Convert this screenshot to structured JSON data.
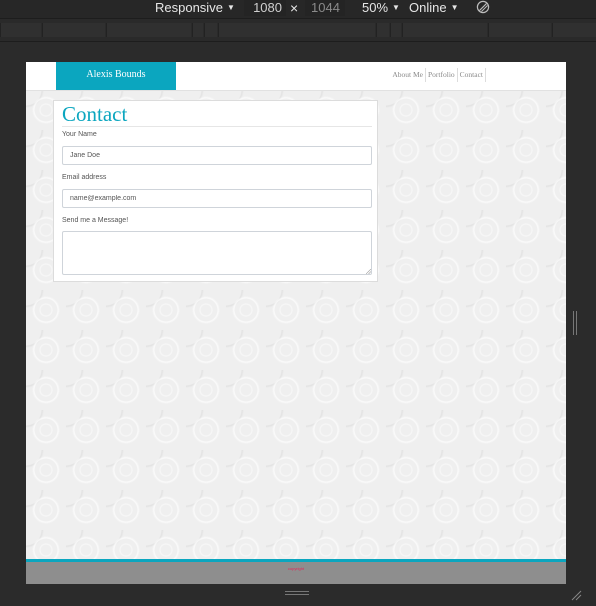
{
  "devtools": {
    "device": "Responsive",
    "width": "1080",
    "separator": "×",
    "height": "1044",
    "zoom": "50%",
    "network": "Online",
    "icons": {
      "caret": "caret-down-icon",
      "rotate": "rotate-icon",
      "resize_corner": "resize-corner-icon"
    }
  },
  "site": {
    "brand": "Alexis Bounds",
    "nav": [
      "About Me",
      "Portfolio",
      "Contact"
    ],
    "accent": "#0ba6bf"
  },
  "form": {
    "title": "Contact",
    "name_label": "Your Name",
    "name_placeholder": "Jane Doe",
    "email_label": "Email address",
    "email_placeholder": "name@example.com",
    "message_label": "Send me a Message!",
    "message_value": ""
  },
  "footer": {
    "text": "copyright"
  }
}
